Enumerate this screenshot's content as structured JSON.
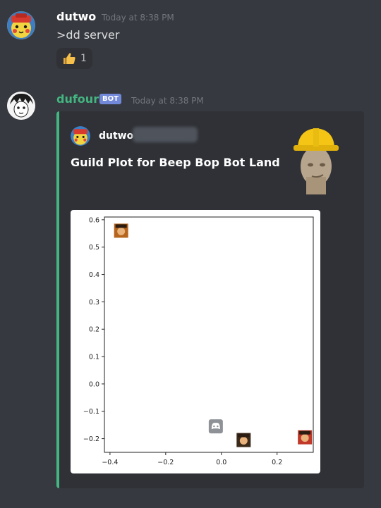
{
  "messages": [
    {
      "author": "dutwo",
      "timestamp": "Today at 8:38 PM",
      "text": ">dd server",
      "reaction": {
        "emoji": "thumbs-up-icon",
        "count": "1"
      }
    },
    {
      "author": "dufour",
      "author_color": "#43b581",
      "tag": "BOT",
      "timestamp": "Today at 8:38 PM",
      "embed": {
        "accent": "#43b581",
        "author_name": "dutwo",
        "title_prefix": "Guild Plot for ",
        "title_bold": "Beep Bop Bot Land"
      }
    }
  ],
  "chart_data": {
    "type": "scatter",
    "title": "",
    "xlabel": "",
    "ylabel": "",
    "xlim": [
      -0.42,
      0.33
    ],
    "ylim": [
      -0.25,
      0.61
    ],
    "xticks": [
      "−0.4",
      "−0.2",
      "0.0",
      "0.2"
    ],
    "xtick_values": [
      -0.4,
      -0.2,
      0.0,
      0.2
    ],
    "yticks": [
      "0.6",
      "0.5",
      "0.4",
      "0.3",
      "0.2",
      "0.1",
      "0.0",
      "−0.1",
      "−0.2"
    ],
    "ytick_values": [
      0.6,
      0.5,
      0.4,
      0.3,
      0.2,
      0.1,
      0.0,
      -0.1,
      -0.2
    ],
    "points": [
      {
        "x": -0.36,
        "y": 0.56,
        "marker": "avatar-icon",
        "color": "#b5651d"
      },
      {
        "x": -0.02,
        "y": -0.155,
        "marker": "discord-logo-icon",
        "color": "#8e9297"
      },
      {
        "x": 0.08,
        "y": -0.205,
        "marker": "avatar-icon",
        "color": "#3b2a1a"
      },
      {
        "x": 0.3,
        "y": -0.195,
        "marker": "avatar-icon",
        "color": "#c0392b"
      }
    ]
  }
}
